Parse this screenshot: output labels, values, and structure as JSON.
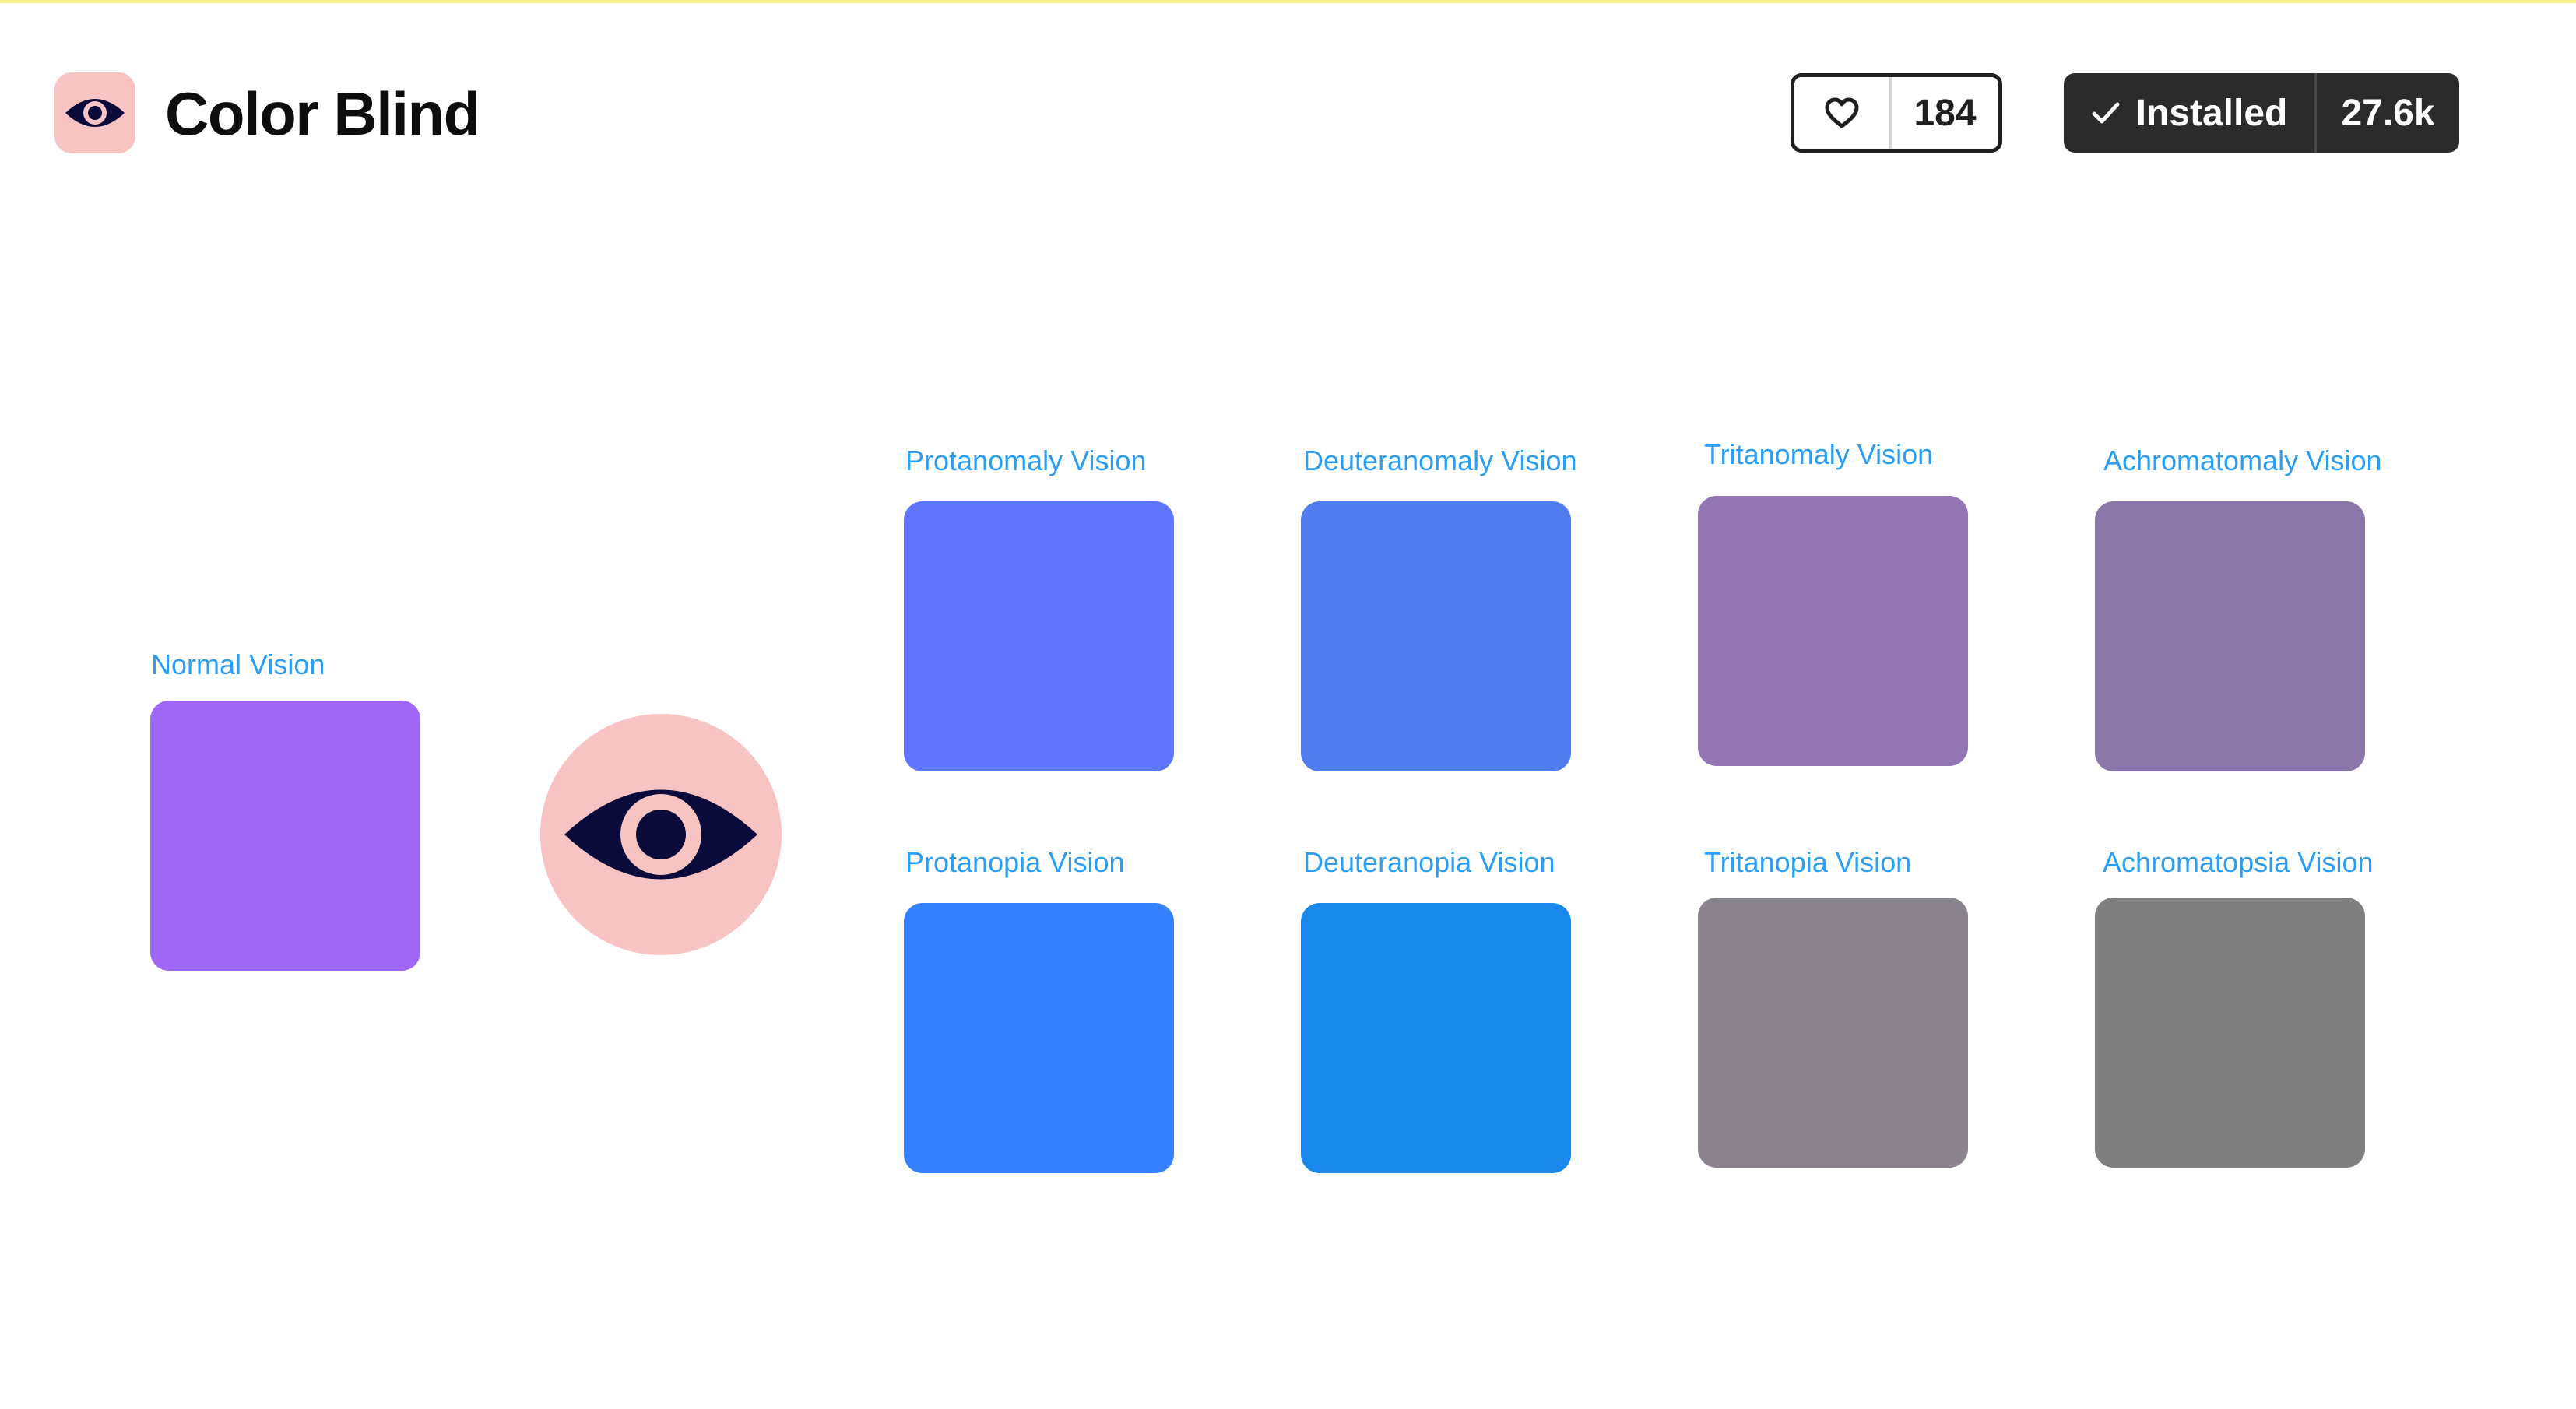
{
  "header": {
    "title": "Color Blind",
    "like_count": "184",
    "installed_label": "Installed",
    "install_count": "27.6k"
  },
  "icons": {
    "app": "eye-icon",
    "like": "heart-outline-icon",
    "installed": "checkmark-icon",
    "hero": "eye-icon"
  },
  "colors": {
    "icon_background": "#f8c3c3",
    "eye": "#0b0b3b",
    "label_text": "#2a9df4"
  },
  "swatches": {
    "normal": {
      "label": "Normal Vision",
      "color": "#a066f5"
    },
    "protanomaly": {
      "label": "Protanomaly Vision",
      "color": "#5f75fc"
    },
    "deuteranomaly": {
      "label": "Deuteranomaly Vision",
      "color": "#507ced"
    },
    "tritanomaly": {
      "label": "Tritanomaly Vision",
      "color": "#9276b4"
    },
    "achromatomaly": {
      "label": "Achromatomaly Vision",
      "color": "#8b76a9"
    },
    "protanopia": {
      "label": "Protanopia Vision",
      "color": "#3581fe"
    },
    "deuteranopia": {
      "label": "Deuteranopia Vision",
      "color": "#1a88ea"
    },
    "tritanopia": {
      "label": "Tritanopia Vision",
      "color": "#8a838e"
    },
    "achromatopsia": {
      "label": "Achromatopsia Vision",
      "color": "#7f7f7f"
    }
  }
}
